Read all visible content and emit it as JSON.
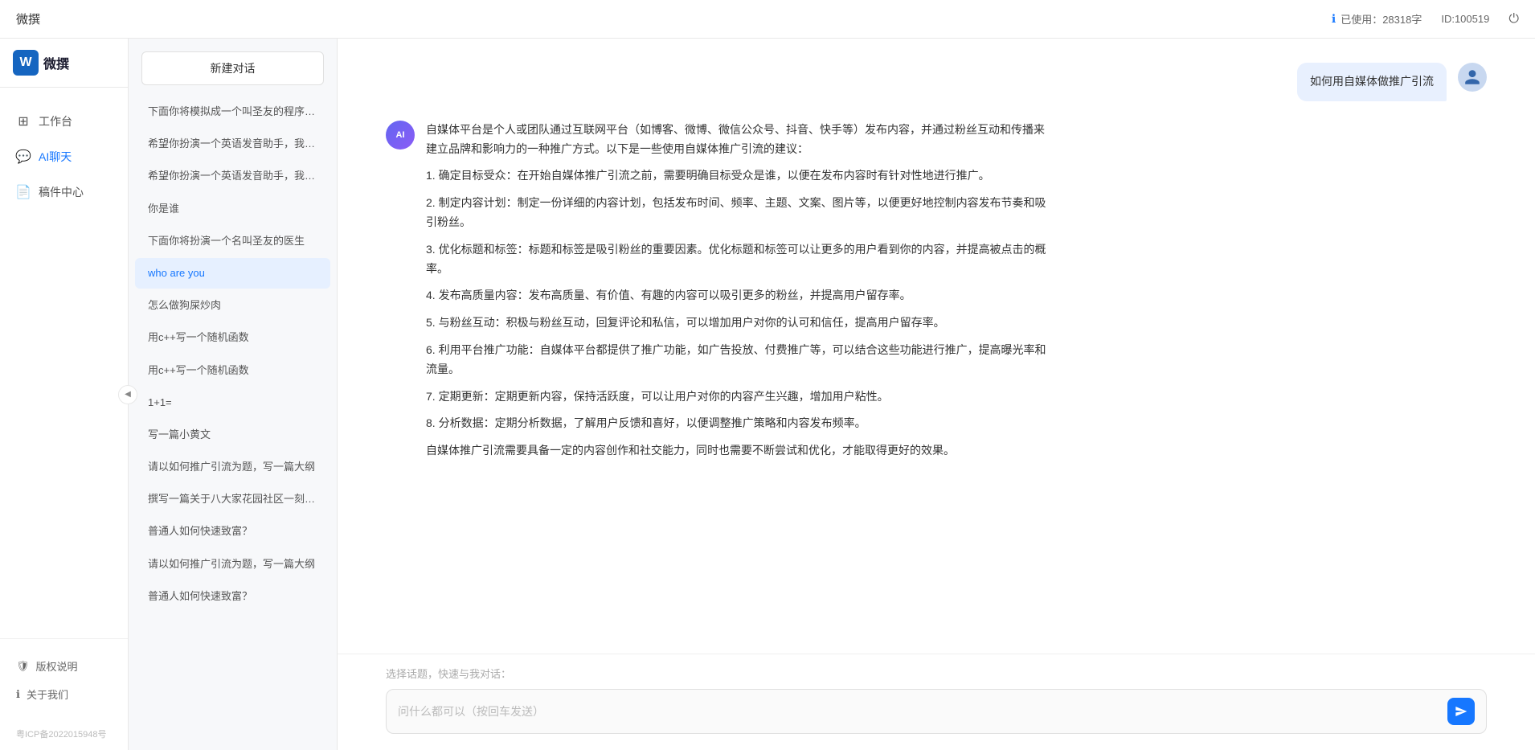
{
  "topbar": {
    "title": "微撰",
    "usage_label": "已使用：28318字",
    "usage_icon": "info-icon",
    "id_label": "ID:100519",
    "logout_icon": "power-icon"
  },
  "logo": {
    "w_letter": "W",
    "brand_name": "微撰"
  },
  "sidebar": {
    "nav_items": [
      {
        "id": "workbench",
        "label": "工作台",
        "icon": "grid-icon"
      },
      {
        "id": "ai-chat",
        "label": "AI聊天",
        "icon": "chat-icon",
        "active": true
      },
      {
        "id": "drafts",
        "label": "稿件中心",
        "icon": "document-icon"
      }
    ],
    "bottom_items": [
      {
        "id": "copyright",
        "label": "版权说明",
        "icon": "shield-icon"
      },
      {
        "id": "about",
        "label": "关于我们",
        "icon": "info-circle-icon"
      }
    ],
    "copyright_text": "粤ICP备2022015948号"
  },
  "chat_history": {
    "new_chat_label": "新建对话",
    "items": [
      {
        "id": 1,
        "text": "下面你将模拟成一个叫圣友的程序员，我说...",
        "active": false
      },
      {
        "id": 2,
        "text": "希望你扮演一个英语发音助手，我提供给你...",
        "active": false
      },
      {
        "id": 3,
        "text": "希望你扮演一个英语发音助手，我提供给你...",
        "active": false
      },
      {
        "id": 4,
        "text": "你是谁",
        "active": false
      },
      {
        "id": 5,
        "text": "下面你将扮演一个名叫圣友的医生",
        "active": false
      },
      {
        "id": 6,
        "text": "who are you",
        "active": true
      },
      {
        "id": 7,
        "text": "怎么做狗屎炒肉",
        "active": false
      },
      {
        "id": 8,
        "text": "用c++写一个随机函数",
        "active": false
      },
      {
        "id": 9,
        "text": "用c++写一个随机函数",
        "active": false
      },
      {
        "id": 10,
        "text": "1+1=",
        "active": false
      },
      {
        "id": 11,
        "text": "写一篇小黄文",
        "active": false
      },
      {
        "id": 12,
        "text": "请以如何推广引流为题，写一篇大纲",
        "active": false
      },
      {
        "id": 13,
        "text": "撰写一篇关于八大家花园社区一刻钟便民生...",
        "active": false
      },
      {
        "id": 14,
        "text": "普通人如何快速致富？",
        "active": false
      },
      {
        "id": 15,
        "text": "请以如何推广引流为题，写一篇大纲",
        "active": false
      },
      {
        "id": 16,
        "text": "普通人如何快速致富？",
        "active": false
      }
    ]
  },
  "chat": {
    "user_message": "如何用自媒体做推广引流",
    "ai_response": {
      "intro": "自媒体平台是个人或团队通过互联网平台（如博客、微博、微信公众号、抖音、快手等）发布内容，并通过粉丝互动和传播来建立品牌和影响力的一种推广方式。以下是一些使用自媒体推广引流的建议：",
      "points": [
        "1. 确定目标受众：在开始自媒体推广引流之前，需要明确目标受众是谁，以便在发布内容时有针对性地进行推广。",
        "2. 制定内容计划：制定一份详细的内容计划，包括发布时间、频率、主题、文案、图片等，以便更好地控制内容发布节奏和吸引粉丝。",
        "3. 优化标题和标签：标题和标签是吸引粉丝的重要因素。优化标题和标签可以让更多的用户看到你的内容，并提高被点击的概率。",
        "4. 发布高质量内容：发布高质量、有价值、有趣的内容可以吸引更多的粉丝，并提高用户留存率。",
        "5. 与粉丝互动：积极与粉丝互动，回复评论和私信，可以增加用户对你的认可和信任，提高用户留存率。",
        "6. 利用平台推广功能：自媒体平台都提供了推广功能，如广告投放、付费推广等，可以结合这些功能进行推广，提高曝光率和流量。",
        "7. 定期更新：定期更新内容，保持活跃度，可以让用户对你的内容产生兴趣，增加用户粘性。",
        "8. 分析数据：定期分析数据，了解用户反馈和喜好，以便调整推广策略和内容发布频率。"
      ],
      "outro": "自媒体推广引流需要具备一定的内容创作和社交能力，同时也需要不断尝试和优化，才能取得更好的效果。"
    },
    "input_placeholder": "问什么都可以（按回车发送）",
    "quick_topics_label": "选择话题，快速与我对话："
  }
}
